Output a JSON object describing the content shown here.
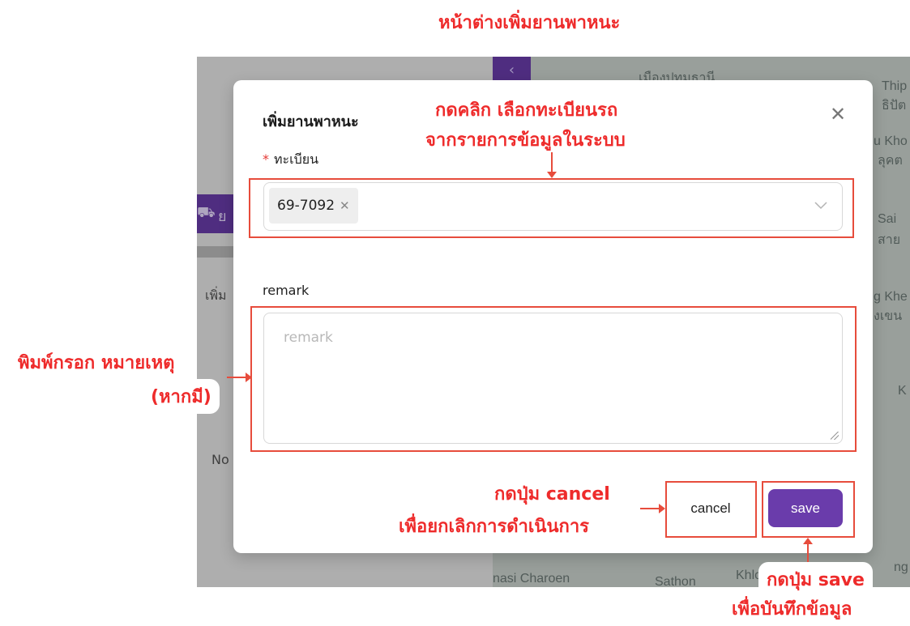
{
  "dialog": {
    "title": "เพิ่มยานพาหนะ",
    "plate_label": "ทะเบียน",
    "plate_required_mark": "*",
    "selected_plate": "69-7092",
    "remark_label": "remark",
    "remark_placeholder": "remark",
    "cancel_label": "cancel",
    "save_label": "save",
    "close_icon": "close-icon",
    "dropdown_icon": "chevron-down-icon"
  },
  "background": {
    "panel_texts": [
      "ย",
      "เพิ่ม",
      "No"
    ],
    "map_labels": [
      "เมืองปทุมธานี",
      "Thip",
      "ธิปัต",
      "u Kho",
      "ลุคต",
      "Sai",
      "สาย",
      "g Khe",
      "งเขน",
      "K",
      "Khlo",
      "nasi Charoen",
      "Sathon",
      "ng"
    ]
  },
  "annotations": {
    "header": "หน้าต่างเพิ่มยานพาหนะ",
    "select_line1": "กดคลิก เลือกทะเบียนรถ",
    "select_line2": "จากรายการข้อมูลในระบบ",
    "remark_line1": "พิมพ์กรอก หมายเหตุ",
    "remark_line2": "(หากมี)",
    "cancel_line1": "กดปุ่ม cancel",
    "cancel_line2": "เพื่อยกเลิกการดำเนินการ",
    "save_line1": "กดปุ่ม save",
    "save_line2": "เพื่อบันทึกข้อมูล"
  },
  "colors": {
    "accent": "#6a3cab",
    "annotation": "#ee2b2b"
  }
}
